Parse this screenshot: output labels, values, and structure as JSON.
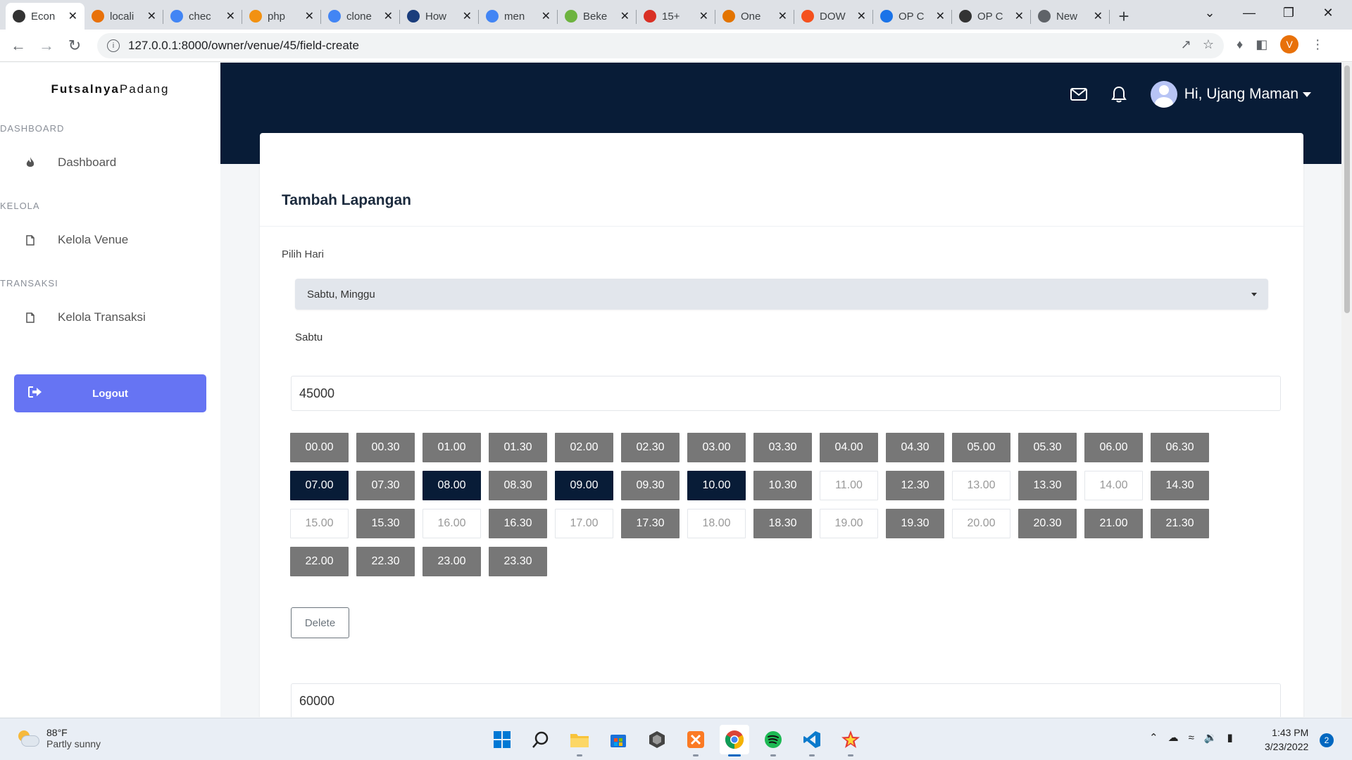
{
  "browser": {
    "tabs": [
      {
        "title": "Econ",
        "fav_color": "#333333",
        "active": true
      },
      {
        "title": "locali",
        "fav_color": "#e8710a"
      },
      {
        "title": "chec",
        "fav_color": "#4285f4"
      },
      {
        "title": "php",
        "fav_color": "#f29111"
      },
      {
        "title": "clone",
        "fav_color": "#4285f4"
      },
      {
        "title": "How",
        "fav_color": "#1a3d7c"
      },
      {
        "title": "men",
        "fav_color": "#4285f4"
      },
      {
        "title": "Beke",
        "fav_color": "#6db33f"
      },
      {
        "title": "15+",
        "fav_color": "#d93025"
      },
      {
        "title": "One",
        "fav_color": "#e37400"
      },
      {
        "title": "DOW",
        "fav_color": "#f4511e"
      },
      {
        "title": "OP C",
        "fav_color": "#1a73e8"
      },
      {
        "title": "OP C",
        "fav_color": "#333333"
      },
      {
        "title": "New",
        "fav_color": "#5f6368"
      }
    ],
    "url": "127.0.0.1:8000/owner/venue/45/field-create",
    "profile_initial": "V"
  },
  "sidebar": {
    "brand_bold": "Futsalnya",
    "brand_light": "Padang",
    "sections": [
      {
        "label": "DASHBOARD",
        "item": "Dashboard",
        "icon": "flame-icon"
      },
      {
        "label": "KELOLA",
        "item": "Kelola Venue",
        "icon": "document-icon"
      },
      {
        "label": "TRANSAKSI",
        "item": "Kelola Transaksi",
        "icon": "document-icon"
      }
    ],
    "logout": "Logout"
  },
  "topnav": {
    "greeting": "Hi, Ujang Maman"
  },
  "form": {
    "title": "Tambah Lapangan",
    "day_label": "Pilih Hari",
    "day_value": "Sabtu, Minggu",
    "current_day": "Sabtu",
    "price_1": "45000",
    "price_2": "60000",
    "delete_label": "Delete",
    "slots": [
      {
        "time": "00.00",
        "state": "available"
      },
      {
        "time": "00.30",
        "state": "available"
      },
      {
        "time": "01.00",
        "state": "available"
      },
      {
        "time": "01.30",
        "state": "available"
      },
      {
        "time": "02.00",
        "state": "available"
      },
      {
        "time": "02.30",
        "state": "available"
      },
      {
        "time": "03.00",
        "state": "available"
      },
      {
        "time": "03.30",
        "state": "available"
      },
      {
        "time": "04.00",
        "state": "available"
      },
      {
        "time": "04.30",
        "state": "available"
      },
      {
        "time": "05.00",
        "state": "available"
      },
      {
        "time": "05.30",
        "state": "available"
      },
      {
        "time": "06.00",
        "state": "available"
      },
      {
        "time": "06.30",
        "state": "available"
      },
      {
        "time": "07.00",
        "state": "selected"
      },
      {
        "time": "07.30",
        "state": "available"
      },
      {
        "time": "08.00",
        "state": "selected"
      },
      {
        "time": "08.30",
        "state": "available"
      },
      {
        "time": "09.00",
        "state": "selected"
      },
      {
        "time": "09.30",
        "state": "available"
      },
      {
        "time": "10.00",
        "state": "selected"
      },
      {
        "time": "10.30",
        "state": "available"
      },
      {
        "time": "11.00",
        "state": "off"
      },
      {
        "time": "12.30",
        "state": "available"
      },
      {
        "time": "13.00",
        "state": "off"
      },
      {
        "time": "13.30",
        "state": "available"
      },
      {
        "time": "14.00",
        "state": "off"
      },
      {
        "time": "14.30",
        "state": "available"
      },
      {
        "time": "15.00",
        "state": "off"
      },
      {
        "time": "15.30",
        "state": "available"
      },
      {
        "time": "16.00",
        "state": "off"
      },
      {
        "time": "16.30",
        "state": "available"
      },
      {
        "time": "17.00",
        "state": "off"
      },
      {
        "time": "17.30",
        "state": "available"
      },
      {
        "time": "18.00",
        "state": "off"
      },
      {
        "time": "18.30",
        "state": "available"
      },
      {
        "time": "19.00",
        "state": "off"
      },
      {
        "time": "19.30",
        "state": "available"
      },
      {
        "time": "20.00",
        "state": "off"
      },
      {
        "time": "20.30",
        "state": "available"
      },
      {
        "time": "21.00",
        "state": "available"
      },
      {
        "time": "21.30",
        "state": "available"
      },
      {
        "time": "22.00",
        "state": "available"
      },
      {
        "time": "22.30",
        "state": "available"
      },
      {
        "time": "23.00",
        "state": "available"
      },
      {
        "time": "23.30",
        "state": "available"
      }
    ]
  },
  "taskbar": {
    "temp": "88°F",
    "weather": "Partly sunny",
    "time": "1:43 PM",
    "date": "3/23/2022",
    "notifications": "2",
    "apps": [
      "start-icon",
      "search-icon",
      "file-explorer-icon",
      "store-icon",
      "unity-icon",
      "xampp-icon",
      "chrome-icon",
      "spotify-icon",
      "vscode-icon",
      "star-app-icon"
    ]
  },
  "colors": {
    "navy": "#081c37",
    "accent": "#6674f3",
    "slot_available": "#777777",
    "slot_selected": "#081c37"
  }
}
